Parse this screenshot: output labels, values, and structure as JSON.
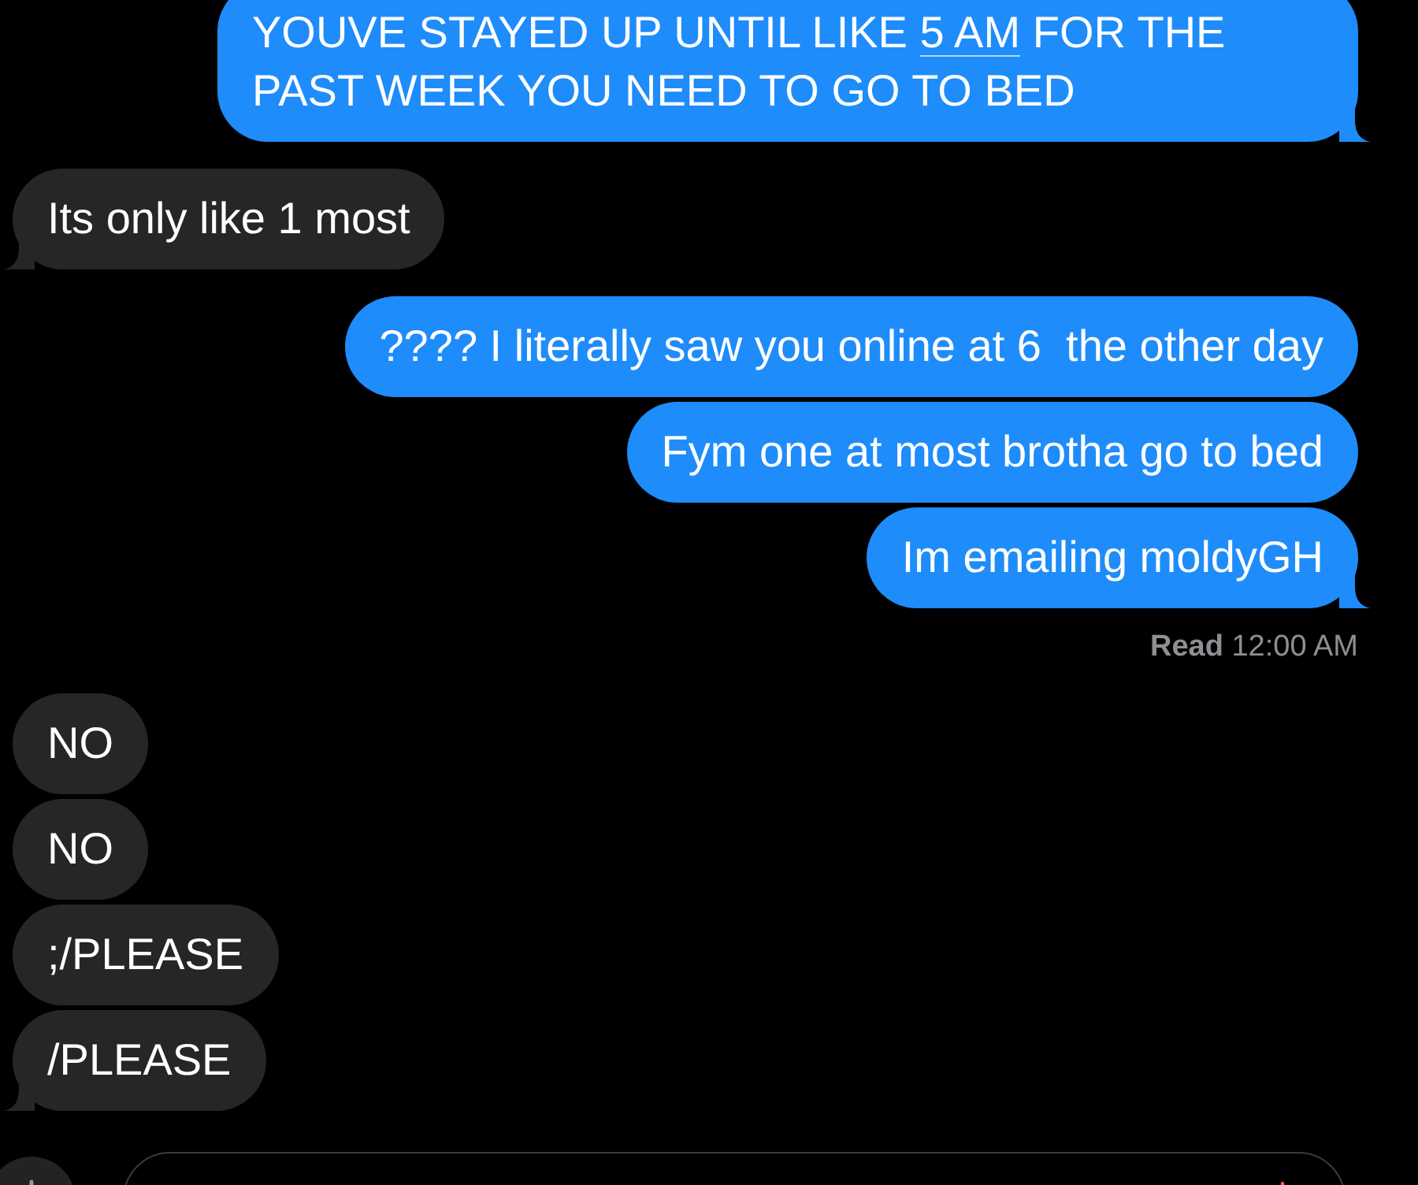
{
  "messages": [
    {
      "kind": "outgoing",
      "parts": [
        {
          "kind": "text",
          "text": "YOUVE STAYED UP UNTIL LIKE "
        },
        {
          "kind": "link",
          "text": "5 AM"
        },
        {
          "kind": "text",
          "text": " FOR THE PAST WEEK YOU NEED TO GO TO BED"
        }
      ]
    },
    {
      "kind": "incoming",
      "parts": [
        {
          "kind": "text",
          "text": "Its only like 1 most"
        }
      ]
    },
    {
      "kind": "outgoing",
      "parts": [
        {
          "kind": "text",
          "text": "???? I literally saw you online at 6  the other day"
        }
      ]
    },
    {
      "kind": "outgoing",
      "parts": [
        {
          "kind": "text",
          "text": "Fym one at most brotha go to bed"
        }
      ]
    },
    {
      "kind": "outgoing",
      "parts": [
        {
          "kind": "text",
          "text": "Im emailing moldyGH"
        }
      ],
      "receipt": "**Read** 12:00 AM"
    },
    {
      "kind": "incoming",
      "parts": [
        {
          "kind": "text",
          "text": "NO"
        }
      ]
    },
    {
      "kind": "incoming",
      "parts": [
        {
          "kind": "text",
          "text": "NO"
        }
      ]
    },
    {
      "kind": "incoming",
      "parts": [
        {
          "kind": "text",
          "text": ";/PLEASE"
        }
      ]
    },
    {
      "kind": "incoming",
      "parts": [
        {
          "kind": "text",
          "text": "/PLEASE"
        }
      ]
    }
  ]
}
